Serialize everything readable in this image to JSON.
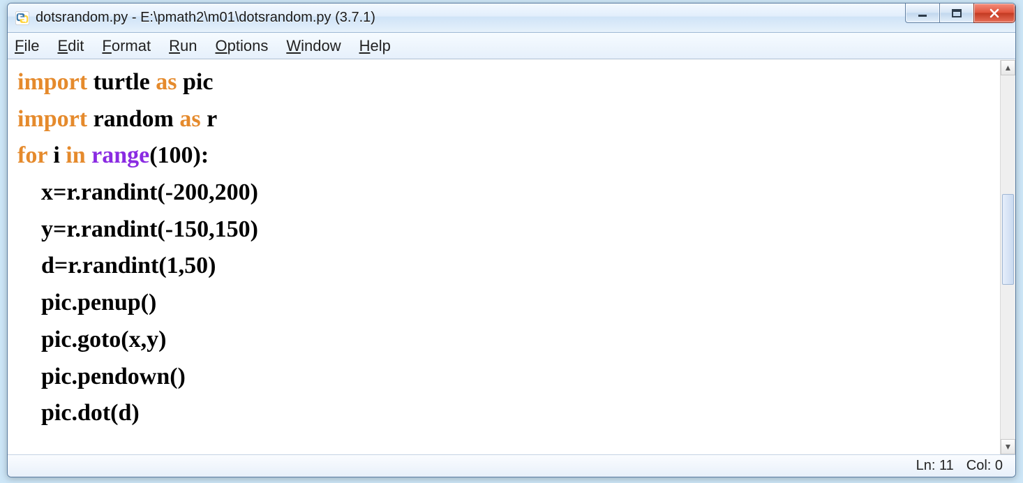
{
  "window": {
    "title": "dotsrandom.py - E:\\pmath2\\m01\\dotsrandom.py (3.7.1)"
  },
  "menu": {
    "file": {
      "mnemonic": "F",
      "rest": "ile"
    },
    "edit": {
      "mnemonic": "E",
      "rest": "dit"
    },
    "format": {
      "mnemonic": "F",
      "rest": "ormat"
    },
    "run": {
      "mnemonic": "R",
      "rest": "un"
    },
    "options": {
      "mnemonic": "O",
      "rest": "ptions"
    },
    "window": {
      "mnemonic": "W",
      "rest": "indow"
    },
    "help": {
      "mnemonic": "H",
      "rest": "elp"
    }
  },
  "code": {
    "l1": {
      "import": "import",
      "sp1": " ",
      "mod": "turtle",
      "sp2": " ",
      "as": "as",
      "sp3": " ",
      "alias": "pic"
    },
    "l2": {
      "import": "import",
      "sp1": " ",
      "mod": "random",
      "sp2": " ",
      "as": "as",
      "sp3": " ",
      "alias": "r"
    },
    "l3": {
      "for": "for",
      "sp1": " ",
      "var": "i",
      "sp2": " ",
      "in": "in",
      "sp3": " ",
      "range": "range",
      "args": "(100):"
    },
    "l4": "    x=r.randint(-200,200)",
    "l5": "    y=r.randint(-150,150)",
    "l6": "    d=r.randint(1,50)",
    "l7": "    pic.penup()",
    "l8": "    pic.goto(x,y)",
    "l9": "    pic.pendown()",
    "l10": "    pic.dot(d)"
  },
  "status": {
    "ln_label": "Ln: ",
    "ln_value": "11",
    "col_label": "Col: ",
    "col_value": "0"
  },
  "icons": {
    "min": "minimize-icon",
    "max": "maximize-icon",
    "close": "close-icon",
    "app": "python-idle-icon",
    "scroll_up": "scroll-up-icon",
    "scroll_down": "scroll-down-icon"
  }
}
